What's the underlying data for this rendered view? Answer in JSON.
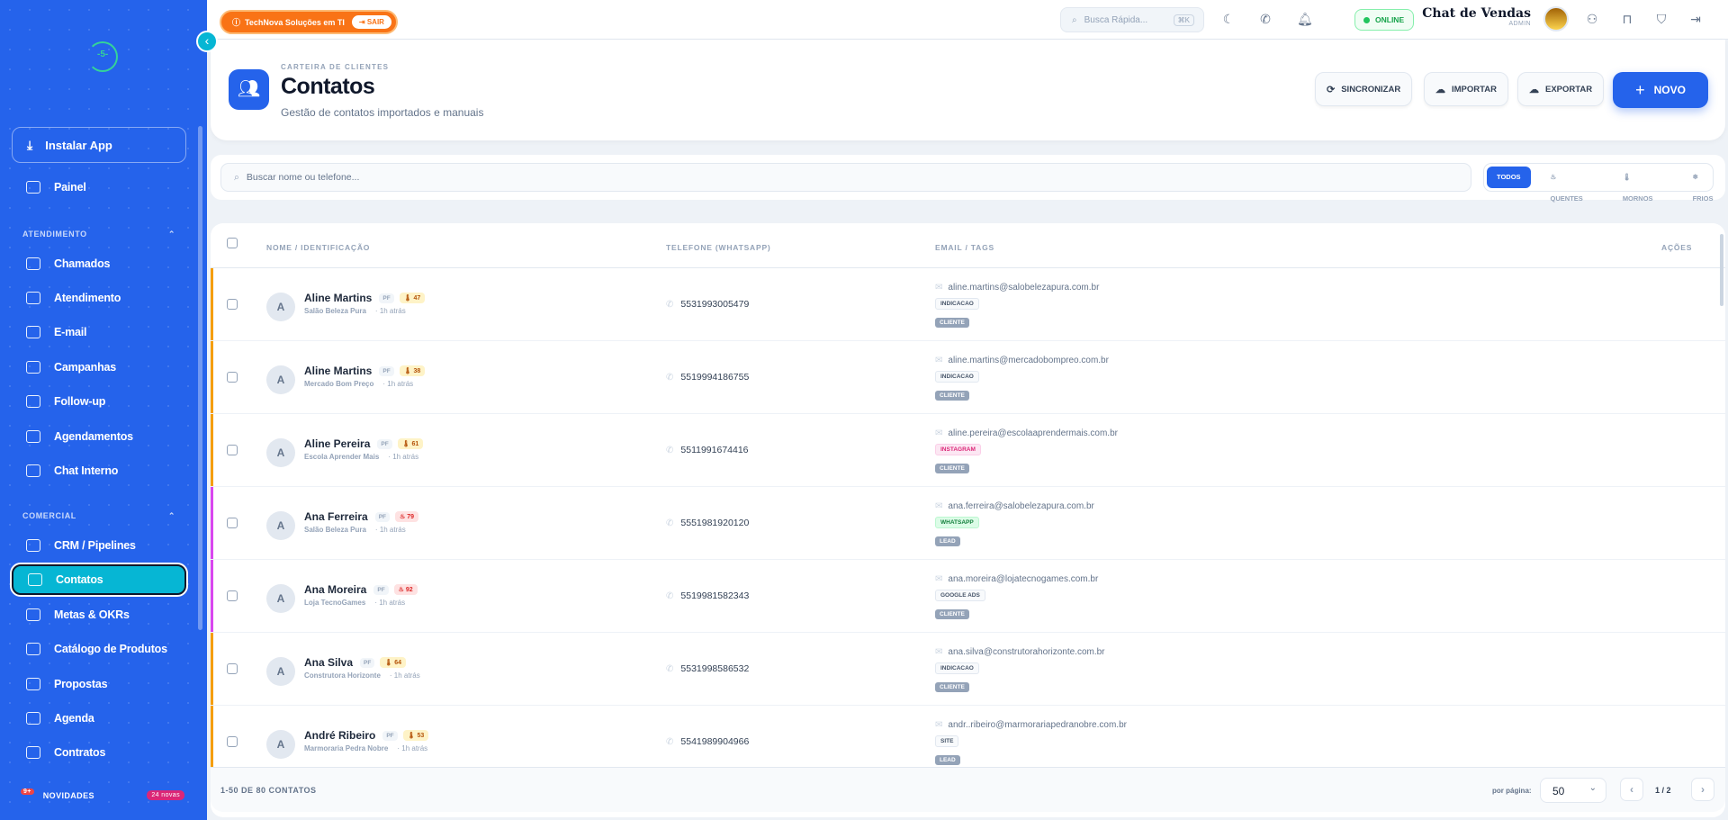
{
  "sidebar": {
    "logo_text": "-5-",
    "install_label": "Instalar App",
    "painel_label": "Painel",
    "section_atendimento": "ATENDIMENTO",
    "section_comercial": "COMERCIAL",
    "items": [
      {
        "label": "Chamados",
        "icon": "ticket-icon"
      },
      {
        "label": "Atendimento",
        "icon": "chat-icon"
      },
      {
        "label": "E-mail",
        "icon": "mail-icon"
      },
      {
        "label": "Campanhas",
        "icon": "megaphone-icon"
      },
      {
        "label": "Follow-up",
        "icon": "repeat-icon"
      },
      {
        "label": "Agendamentos",
        "icon": "calendar-clock-icon"
      },
      {
        "label": "Chat Interno",
        "icon": "message-icon"
      },
      {
        "label": "CRM / Pipelines",
        "icon": "pipeline-icon"
      },
      {
        "label": "Contatos",
        "icon": "contacts-icon",
        "active": true
      },
      {
        "label": "Metas & OKRs",
        "icon": "target-icon"
      },
      {
        "label": "Catálogo de Produtos",
        "icon": "catalog-icon"
      },
      {
        "label": "Propostas",
        "icon": "document-icon"
      },
      {
        "label": "Agenda",
        "icon": "calendar-icon"
      },
      {
        "label": "Contratos",
        "icon": "contract-icon"
      }
    ],
    "news_label": "NOVIDADES",
    "news_badge": "9+",
    "news_pill": "24 novas"
  },
  "topbar": {
    "tenant_label": "TechNova Soluções em TI",
    "exit_label": "SAIR",
    "quick_search_placeholder": "Busca Rápida...",
    "quick_search_shortcut": "⌘K",
    "status_label": "ONLINE",
    "app_name": "Chat de Vendas",
    "role_label": "ADMIN"
  },
  "header": {
    "kicker": "CARTEIRA DE CLIENTES",
    "title": "Contatos",
    "subtitle": "Gestão de contatos importados e manuais",
    "sync_label": "SINCRONIZAR",
    "import_label": "IMPORTAR",
    "export_label": "EXPORTAR",
    "new_label": "NOVO"
  },
  "filters": {
    "search_placeholder": "Buscar nome ou telefone...",
    "segments": [
      "TODOS",
      "QUENTES",
      "MORNOS",
      "FRIOS"
    ],
    "active_segment": "TODOS"
  },
  "table": {
    "columns": [
      "NOME / IDENTIFICAÇÃO",
      "TELEFONE (WHATSAPP)",
      "EMAIL / TAGS",
      "AÇÕES"
    ],
    "rows": [
      {
        "initial": "A",
        "name": "Aline Martins",
        "kind": "PF",
        "score": "47",
        "temp": "warm",
        "company": "Salão Beleza Pura",
        "time": "1h atrás",
        "phone": "5531993005479",
        "email": "aline.martins@salobelezapura.com.br",
        "tag": "INDICACAO",
        "tag_style": "neutral",
        "type": "CLIENTE",
        "accent": "#f59e0b"
      },
      {
        "initial": "A",
        "name": "Aline Martins",
        "kind": "PF",
        "score": "38",
        "temp": "warm",
        "company": "Mercado Bom Preço",
        "time": "1h atrás",
        "phone": "5519994186755",
        "email": "aline.martins@mercadobompreo.com.br",
        "tag": "INDICACAO",
        "tag_style": "neutral",
        "type": "CLIENTE",
        "accent": "#f59e0b"
      },
      {
        "initial": "A",
        "name": "Aline Pereira",
        "kind": "PF",
        "score": "61",
        "temp": "warm",
        "company": "Escola Aprender Mais",
        "time": "1h atrás",
        "phone": "5511991674416",
        "email": "aline.pereira@escolaaprendermais.com.br",
        "tag": "INSTAGRAM",
        "tag_style": "pink",
        "type": "CLIENTE",
        "accent": "#f59e0b"
      },
      {
        "initial": "A",
        "name": "Ana Ferreira",
        "kind": "PF",
        "score": "79",
        "temp": "hot",
        "company": "Salão Beleza Pura",
        "time": "1h atrás",
        "phone": "5551981920120",
        "email": "ana.ferreira@salobelezapura.com.br",
        "tag": "WHATSAPP",
        "tag_style": "green",
        "type": "LEAD",
        "accent": "#d946ef"
      },
      {
        "initial": "A",
        "name": "Ana Moreira",
        "kind": "PF",
        "score": "92",
        "temp": "hot",
        "company": "Loja TecnoGames",
        "time": "1h atrás",
        "phone": "5519981582343",
        "email": "ana.moreira@lojatecnogames.com.br",
        "tag": "GOOGLE ADS",
        "tag_style": "neutral",
        "type": "CLIENTE",
        "accent": "#d946ef"
      },
      {
        "initial": "A",
        "name": "Ana Silva",
        "kind": "PF",
        "score": "64",
        "temp": "warm",
        "company": "Construtora Horizonte",
        "time": "1h atrás",
        "phone": "5531998586532",
        "email": "ana.silva@construtorahorizonte.com.br",
        "tag": "INDICACAO",
        "tag_style": "neutral",
        "type": "CLIENTE",
        "accent": "#f59e0b"
      },
      {
        "initial": "A",
        "name": "André Ribeiro",
        "kind": "PF",
        "score": "53",
        "temp": "warm",
        "company": "Marmoraria Pedra Nobre",
        "time": "1h atrás",
        "phone": "5541989904966",
        "email": "andr..ribeiro@marmorariapedranobre.com.br",
        "tag": "SITE",
        "tag_style": "neutral",
        "type": "LEAD",
        "accent": "#f59e0b"
      }
    ]
  },
  "footer": {
    "count_label": "1-50 DE 80 CONTATOS",
    "per_page_label": "por página:",
    "per_page_value": "50",
    "page_label": "1 / 2"
  }
}
